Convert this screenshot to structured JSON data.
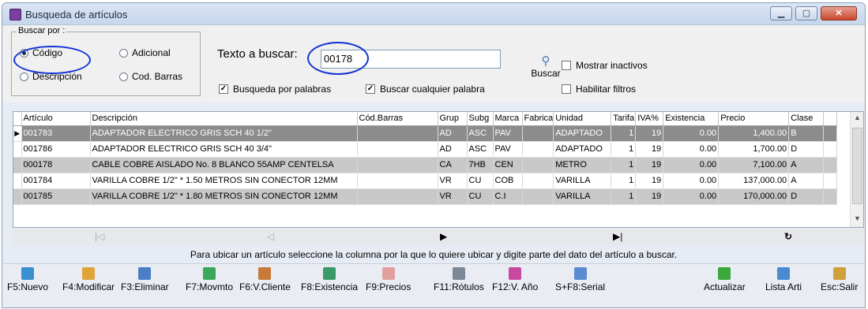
{
  "window": {
    "title": "Busqueda de artículos",
    "min_label": "▁",
    "max_label": "▢",
    "close_label": "✕"
  },
  "search": {
    "group_label": "Buscar por :",
    "options": [
      {
        "label": "Código",
        "selected": true
      },
      {
        "label": "Adicional",
        "selected": false
      },
      {
        "label": "Descripción",
        "selected": false
      },
      {
        "label": "Cod. Barras",
        "selected": false
      }
    ],
    "text_label": "Texto a buscar:",
    "text_value": "00178",
    "button_label": "Buscar",
    "by_words": {
      "label": "Busqueda por palabras",
      "checked": true
    },
    "any_word": {
      "label": "Buscar cualquier palabra",
      "checked": true
    },
    "show_inactive": {
      "label": "Mostrar inactivos",
      "checked": false
    },
    "enable_filters": {
      "label": "Habilitar filtros",
      "checked": false
    }
  },
  "grid": {
    "columns": [
      "Artículo",
      "Descripción",
      "Cód.Barras",
      "Grup",
      "Subg",
      "Marca",
      "Fabrica",
      "Unidad",
      "Tarifa",
      "IVA%",
      "Existencia",
      "Precio",
      "Clase"
    ],
    "rows": [
      [
        "001783",
        "ADAPTADOR ELECTRICO GRIS SCH 40     1/2\"",
        "",
        "AD",
        "ASC",
        "PAV",
        "",
        "ADAPTADO",
        "1",
        "19",
        "0.00",
        "1,400.00",
        "B"
      ],
      [
        "001786",
        "ADAPTADOR ELECTRICO GRIS SCH 40     3/4\"",
        "",
        "AD",
        "ASC",
        "PAV",
        "",
        "ADAPTADO",
        "1",
        "19",
        "0.00",
        "1,700.00",
        "D"
      ],
      [
        "000178",
        "CABLE COBRE AISLADO No.  8 BLANCO 55AMP CENTELSA",
        "",
        "CA",
        "7HB",
        "CEN",
        "",
        "METRO",
        "1",
        "19",
        "0.00",
        "7,100.00",
        "A"
      ],
      [
        "001784",
        "VARILLA COBRE 1/2\" * 1.50 METROS SIN CONECTOR 12MM",
        "",
        "VR",
        "CU",
        "COB",
        "",
        "VARILLA",
        "1",
        "19",
        "0.00",
        "137,000.00",
        "A"
      ],
      [
        "001785",
        "VARILLA COBRE 1/2\" * 1.80 METROS SIN CONECTOR 12MM",
        "",
        "VR",
        "CU",
        "C.I",
        "",
        "VARILLA",
        "1",
        "19",
        "0.00",
        "170,000.00",
        "D"
      ]
    ],
    "selected_row": 0
  },
  "nav": {
    "first": "|◁",
    "prev": "◁",
    "next": "▶",
    "last": "▶|",
    "refresh": "↻"
  },
  "hint": "Para ubicar un artículo seleccione la columna por la que lo quiere ubicar y digite parte del dato del artículo a buscar.",
  "toolbar": [
    {
      "label": "F5:Nuevo",
      "icon": "new-icon",
      "color": "#3a8fd0"
    },
    {
      "label": "F4:Modificar",
      "icon": "edit-icon",
      "color": "#e0a53a"
    },
    {
      "label": "F3:Eliminar",
      "icon": "delete-icon",
      "color": "#4a7fc8"
    },
    {
      "label": "F7:Movmto",
      "icon": "movement-icon",
      "color": "#3aa85a"
    },
    {
      "label": "F6:V.Cliente",
      "icon": "client-icon",
      "color": "#c87a3a"
    },
    {
      "label": "F8:Existencia",
      "icon": "stock-icon",
      "color": "#3a9a6a"
    },
    {
      "label": "F9:Precios",
      "icon": "price-icon",
      "color": "#e0a0a0"
    },
    {
      "label": "F11:Rótulos",
      "icon": "print-icon",
      "color": "#7a8898"
    },
    {
      "label": "F12:V. Año",
      "icon": "chart-icon",
      "color": "#c84aa0"
    },
    {
      "label": "S+F8:Serial",
      "icon": "serial-icon",
      "color": "#5a8ad0"
    },
    {
      "label": "Actualizar",
      "icon": "refresh-icon",
      "color": "#3aa83a"
    },
    {
      "label": "Lista Arti",
      "icon": "list-icon",
      "color": "#4a8ad0"
    },
    {
      "label": "Esc:Salir",
      "icon": "exit-icon",
      "color": "#d0a03a"
    }
  ]
}
